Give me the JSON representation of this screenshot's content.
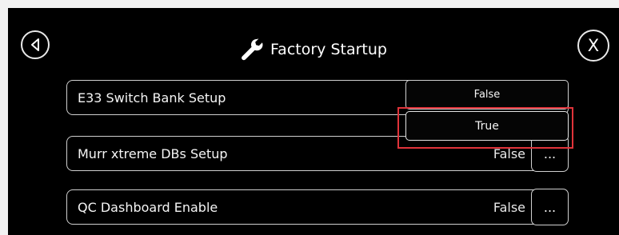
{
  "header": {
    "title": "Factory Startup",
    "back_icon": "back-icon",
    "close_label": "X",
    "title_icon": "wrench-icon"
  },
  "settings": [
    {
      "label": "E33 Switch Bank Setup",
      "value": "False",
      "more_label": "..."
    },
    {
      "label": "Murr xtreme DBs Setup",
      "value": "False",
      "more_label": "..."
    },
    {
      "label": "QC Dashboard Enable",
      "value": "False",
      "more_label": "..."
    }
  ],
  "dropdown": {
    "options": [
      "False",
      "True"
    ],
    "highlighted": "True",
    "highlight_color": "#e0333a"
  }
}
